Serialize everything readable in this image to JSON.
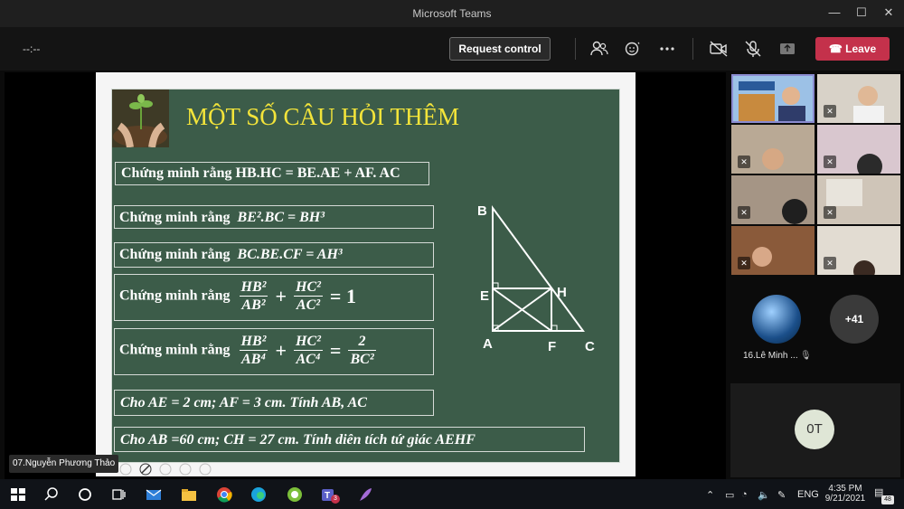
{
  "window": {
    "title": "Microsoft Teams"
  },
  "toolbar": {
    "timer": "--:--",
    "request_control_label": "Request control",
    "leave_label": "Leave"
  },
  "slide": {
    "title": "MỘT SỐ CÂU HỎI THÊM",
    "q1": "Chứng minh rằng  HB.HC = BE.AE + AF. AC",
    "q2_prefix": "Chứng minh rằng",
    "q2_math": "BE².BC = BH³",
    "q3_prefix": "Chứng minh rằng",
    "q3_math": "BC.BE.CF = AH³",
    "q4_prefix": "Chứng minh rằng",
    "q4_eq": "= 1",
    "q5_prefix": "Chứng minh rằng",
    "q6": "Cho AE = 2 cm; AF = 3 cm. Tính AB, AC",
    "q7": "Cho AB =60 cm; CH =  27  cm. Tính diên tích tứ giác AEHF",
    "frac": {
      "hb2": "HB²",
      "ab2": "AB²",
      "hc2": "HC²",
      "ac2": "AC²",
      "ab4": "AB⁴",
      "ac4": "AC⁴",
      "two": "2",
      "bc2": "BC²"
    },
    "diagram_labels": {
      "B": "B",
      "E": "E",
      "H": "H",
      "A": "A",
      "F": "F",
      "C": "C"
    }
  },
  "presenter_tag": "07.Nguyễn Phương Thảo",
  "participants": {
    "name_1": "16.Lê Minh ...",
    "overflow": "+41",
    "initials": "0T"
  },
  "taskbar": {
    "time": "4:35 PM",
    "date": "9/21/2021",
    "lang": "ENG",
    "notifications": "48",
    "teams_badge": "3"
  },
  "colors": {
    "leave": "#c4314b",
    "board": "#3c5c49",
    "title": "#f3e43a"
  }
}
